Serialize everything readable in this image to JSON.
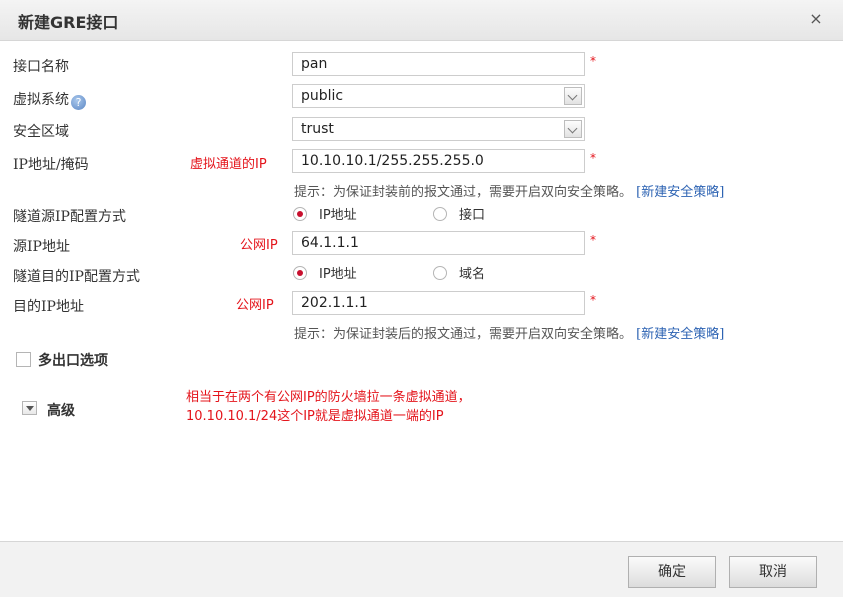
{
  "dialog": {
    "title": "新建GRE接口",
    "close_icon": "×"
  },
  "fields": {
    "interface_name": {
      "label": "接口名称",
      "value": "pan"
    },
    "virtual_system": {
      "label": "虚拟系统",
      "value": "public",
      "help_icon": "?"
    },
    "security_zone": {
      "label": "安全区域",
      "value": "trust"
    },
    "ip_mask": {
      "label": "IP地址/掩码",
      "value": "10.10.10.1/255.255.255.0",
      "annotation": "虚拟通道的IP"
    },
    "hint_1": {
      "text": "提示：为保证封装前的报文通过，需要开启双向安全策略。",
      "link": "[新建安全策略]"
    },
    "tunnel_source_mode": {
      "label": "隧道源IP配置方式",
      "options": [
        "IP地址",
        "接口"
      ],
      "selected": "IP地址"
    },
    "source_ip": {
      "label": "源IP地址",
      "value": "64.1.1.1",
      "annotation": "公网IP"
    },
    "tunnel_dest_mode": {
      "label": "隧道目的IP配置方式",
      "options": [
        "IP地址",
        "域名"
      ],
      "selected": "IP地址"
    },
    "dest_ip": {
      "label": "目的IP地址",
      "value": "202.1.1.1",
      "annotation": "公网IP"
    },
    "hint_2": {
      "text": "提示：为保证封装后的报文通过，需要开启双向安全策略。",
      "link": "[新建安全策略]"
    },
    "required_mark": "*"
  },
  "multi_exit": {
    "label": "多出口选项",
    "checked": false
  },
  "advanced": {
    "label": "高级"
  },
  "note": {
    "line1": "相当于在两个有公网IP的防火墙拉一条虚拟通道，",
    "line2": "10.10.10.1/24这个IP就是虚拟通道一端的IP"
  },
  "footer": {
    "ok_label": "确定",
    "cancel_label": "取消"
  },
  "colors": {
    "required": "#e4141b",
    "annotation": "#e4141b",
    "link": "#2d63b3",
    "radio_selected": "#c8102e"
  }
}
